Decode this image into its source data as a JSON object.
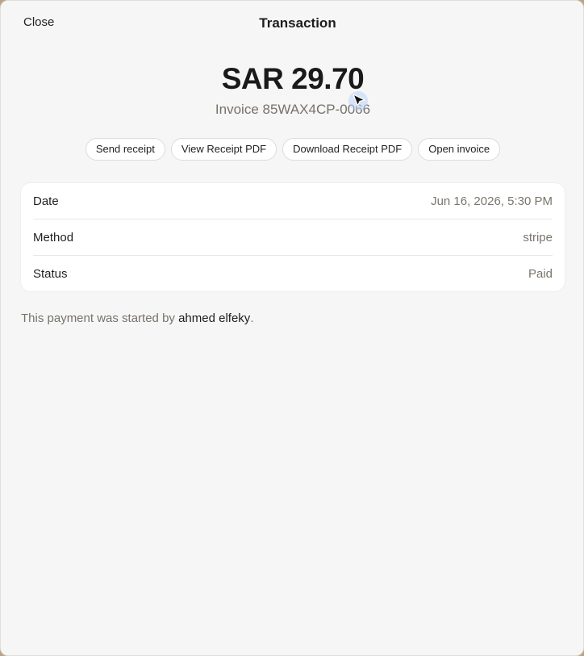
{
  "header": {
    "close_label": "Close",
    "title": "Transaction"
  },
  "summary": {
    "amount": "SAR 29.70",
    "invoice": "Invoice 85WAX4CP-0066"
  },
  "actions": {
    "send_receipt": "Send receipt",
    "view_receipt_pdf": "View Receipt PDF",
    "download_receipt_pdf": "Download Receipt PDF",
    "open_invoice": "Open invoice"
  },
  "details": {
    "date_label": "Date",
    "date_value": "Jun 16, 2026, 5:30 PM",
    "method_label": "Method",
    "method_value": "stripe",
    "status_label": "Status",
    "status_value": "Paid"
  },
  "note": {
    "prefix": "This payment was started by ",
    "user": "ahmed elfeky",
    "suffix": "."
  }
}
